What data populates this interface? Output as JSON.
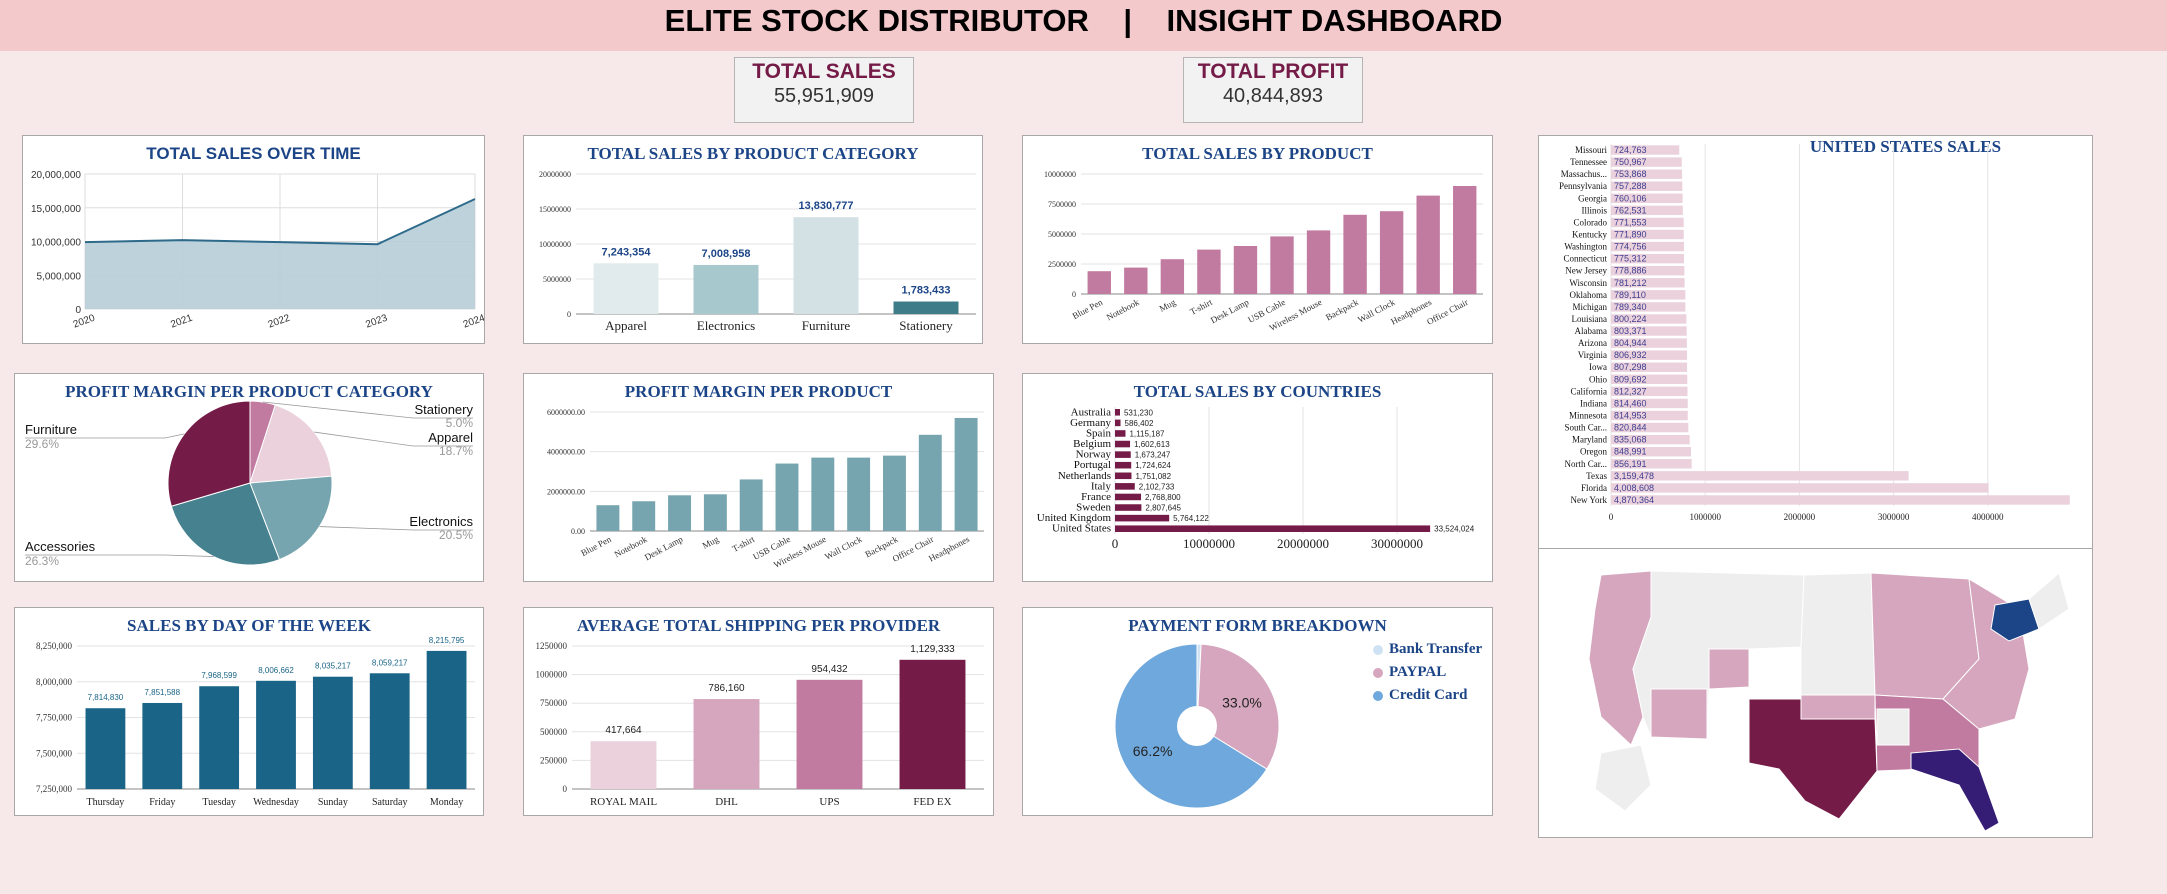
{
  "header": {
    "title": "ELITE STOCK DISTRIBUTOR    |    INSIGHT DASHBOARD"
  },
  "kpis": {
    "sales": {
      "label": "TOTAL SALES",
      "value": "55,951,909"
    },
    "profit": {
      "label": "TOTAL PROFIT",
      "value": "40,844,893"
    }
  },
  "colors": {
    "dark": "#741b47",
    "mid": "#c27ba0",
    "light": "#ead1dc",
    "lighter": "#d5a6bd",
    "blue": "#1c4587",
    "teal": "#76a5af",
    "navy": "#1a6487",
    "area": "#b7cdd8"
  },
  "chart_data": [
    {
      "id": "sales_over_time",
      "type": "area",
      "title": "TOTAL SALES OVER TIME",
      "x": [
        "2020",
        "2021",
        "2022",
        "2023",
        "2024"
      ],
      "values": [
        9900000,
        10200000,
        9900000,
        9600000,
        16300000
      ],
      "ylim": [
        0,
        20000000
      ],
      "yticks": [
        "0",
        "5,000,000",
        "10,000,000",
        "15,000,000",
        "20,000,000"
      ]
    },
    {
      "id": "sales_by_category",
      "type": "bar",
      "title": "TOTAL SALES BY PRODUCT CATEGORY",
      "categories": [
        "Apparel",
        "Electronics",
        "Furniture",
        "Stationery"
      ],
      "values": [
        7243354,
        7008958,
        13830777,
        1783433
      ],
      "labels": [
        "7,243,354",
        "7,008,958",
        "13,830,777",
        "1,783,433"
      ],
      "ylim": [
        0,
        20000000
      ],
      "yticks": [
        "0",
        "5000000",
        "10000000",
        "15000000",
        "20000000"
      ]
    },
    {
      "id": "sales_by_product",
      "type": "bar",
      "title": "TOTAL SALES BY PRODUCT",
      "categories": [
        "Blue Pen",
        "Notebook",
        "Mug",
        "T-shirt",
        "Desk Lamp",
        "USB Cable",
        "Wireless Mouse",
        "Backpack",
        "Wall Clock",
        "Headphones",
        "Office Chair"
      ],
      "values": [
        1900000,
        2200000,
        2900000,
        3700000,
        4000000,
        4800000,
        5300000,
        6600000,
        6900000,
        8200000,
        9000000
      ],
      "ylim": [
        0,
        10000000
      ],
      "yticks": [
        "0",
        "2500000",
        "5000000",
        "7500000",
        "10000000"
      ]
    },
    {
      "id": "us_sales",
      "type": "bar",
      "title": "UNITED STATES SALES",
      "categories": [
        "Missouri",
        "Tennessee",
        "Massachus...",
        "Pennsylvania",
        "Georgia",
        "Illinois",
        "Colorado",
        "Kentucky",
        "Washington",
        "Connecticut",
        "New Jersey",
        "Wisconsin",
        "Oklahoma",
        "Michigan",
        "Louisiana",
        "Alabama",
        "Arizona",
        "Virginia",
        "Iowa",
        "Ohio",
        "California",
        "Indiana",
        "Minnesota",
        "South Car...",
        "Maryland",
        "Oregon",
        "North Car...",
        "Texas",
        "Florida",
        "New York"
      ],
      "values": [
        724763,
        750967,
        753868,
        757288,
        760106,
        762531,
        771553,
        771890,
        774756,
        775312,
        778886,
        781212,
        789110,
        789340,
        800224,
        803371,
        804944,
        806932,
        807298,
        809692,
        812327,
        814460,
        814953,
        820844,
        835068,
        848991,
        856191,
        3159478,
        4008608,
        4870364
      ],
      "labels": [
        "724,763",
        "750,967",
        "753,868",
        "757,288",
        "760,106",
        "762,531",
        "771,553",
        "771,890",
        "774,756",
        "775,312",
        "778,886",
        "781,212",
        "789,110",
        "789,340",
        "800,224",
        "803,371",
        "804,944",
        "806,932",
        "807,298",
        "809,692",
        "812,327",
        "814,460",
        "814,953",
        "820,844",
        "835,068",
        "848,991",
        "856,191",
        "3,159,478",
        "4,008,608",
        "4,870,364"
      ],
      "xticks": [
        "0",
        "1000000",
        "2000000",
        "3000000",
        "4000000"
      ],
      "xlim": [
        0,
        5000000
      ]
    },
    {
      "id": "profit_margin_category",
      "type": "pie",
      "title": "PROFIT MARGIN PER PRODUCT CATEGORY",
      "categories": [
        "Stationery",
        "Apparel",
        "Electronics",
        "Accessories",
        "Furniture"
      ],
      "values": [
        5.0,
        18.7,
        20.5,
        26.3,
        29.6
      ],
      "labels": [
        "5.0%",
        "18.7%",
        "20.5%",
        "26.3%",
        "29.6%"
      ]
    },
    {
      "id": "profit_margin_product",
      "type": "bar",
      "title": "PROFIT MARGIN PER PRODUCT",
      "categories": [
        "Blue Pen",
        "Notebook",
        "Desk Lamp",
        "Mug",
        "T-shirt",
        "USB Cable",
        "Wireless Mouse",
        "Wall Clock",
        "Backpack",
        "Office Chair",
        "Headphones"
      ],
      "values": [
        1300000,
        1500000,
        1800000,
        1850000,
        2600000,
        3400000,
        3700000,
        3700000,
        3800000,
        4850000,
        5700000
      ],
      "ylim": [
        0,
        6000000
      ],
      "yticks": [
        "0.00",
        "2000000.00",
        "4000000.00",
        "6000000.00"
      ]
    },
    {
      "id": "sales_by_country",
      "type": "bar",
      "title": "TOTAL SALES BY COUNTRIES",
      "categories": [
        "Australia",
        "Germany",
        "Spain",
        "Belgium",
        "Norway",
        "Portugal",
        "Netherlands",
        "Italy",
        "France",
        "Sweden",
        "United Kingdom",
        "United States"
      ],
      "values": [
        531230,
        586402,
        1115187,
        1602613,
        1673247,
        1724624,
        1751082,
        2102733,
        2768800,
        2807645,
        5764122,
        33524024
      ],
      "labels": [
        "531,230",
        "586,402",
        "1,115,187",
        "1,602,613",
        "1,673,247",
        "1,724,624",
        "1,751,082",
        "2,102,733",
        "2,768,800",
        "2,807,645",
        "5,764,122",
        "33,524,024"
      ],
      "xticks": [
        "0",
        "10000000",
        "20000000",
        "30000000"
      ],
      "xlim": [
        0,
        40000000
      ]
    },
    {
      "id": "sales_by_weekday",
      "type": "bar",
      "title": "SALES BY DAY OF THE WEEK",
      "categories": [
        "Thursday",
        "Friday",
        "Tuesday",
        "Wednesday",
        "Sunday",
        "Saturday",
        "Monday"
      ],
      "values": [
        7814830,
        7851588,
        7968599,
        8006662,
        8035217,
        8059217,
        8215795
      ],
      "labels": [
        "7,814,830",
        "7,851,588",
        "7,968,599",
        "8,006,662",
        "8,035,217",
        "8,059,217",
        "8,215,795"
      ],
      "ylim": [
        7250000,
        8250000
      ],
      "yticks": [
        "7,250,000",
        "7,500,000",
        "7,750,000",
        "8,000,000",
        "8,250,000"
      ]
    },
    {
      "id": "shipping_per_provider",
      "type": "bar",
      "title": "AVERAGE TOTAL SHIPPING PER PROVIDER",
      "categories": [
        "ROYAL MAIL",
        "DHL",
        "UPS",
        "FED EX"
      ],
      "values": [
        417664,
        786160,
        954432,
        1129333
      ],
      "labels": [
        "417,664",
        "786,160",
        "954,432",
        "1,129,333"
      ],
      "ylim": [
        0,
        1250000
      ],
      "yticks": [
        "0",
        "250000",
        "500000",
        "750000",
        "1000000",
        "1250000"
      ]
    },
    {
      "id": "payment_form",
      "type": "pie",
      "title": "PAYMENT FORM BREAKDOWN",
      "categories": [
        "Bank Transfer",
        "PAYPAL",
        "Credit Card"
      ],
      "values": [
        0.8,
        33.0,
        66.2
      ],
      "labels": [
        "",
        "33.0%",
        "66.2%"
      ],
      "series_colors": [
        "#cfe2f3",
        "#d5a6bd",
        "#6fa8dc"
      ]
    }
  ],
  "map": {
    "highlight": [
      "New York",
      "Florida",
      "Texas"
    ]
  }
}
